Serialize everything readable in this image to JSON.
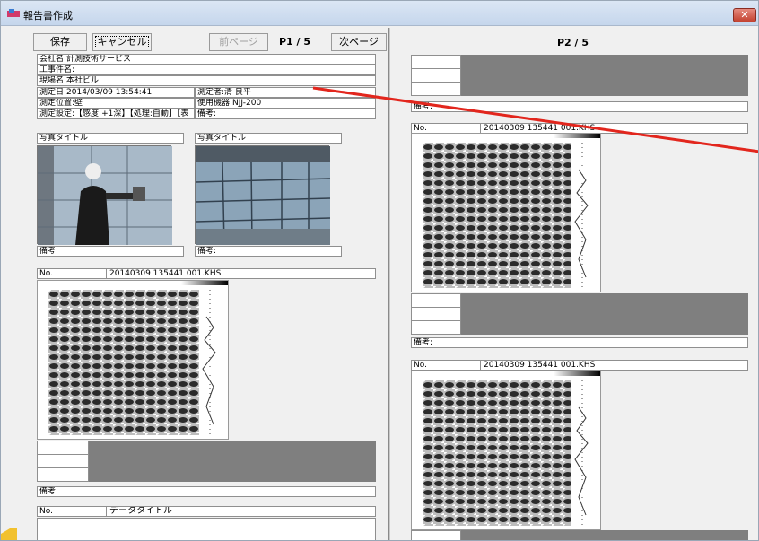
{
  "window": {
    "title": "報告書作成",
    "close_label": "✕"
  },
  "toolbar": {
    "save": "保存",
    "cancel": "キャンセル",
    "prev": "前ページ",
    "page_indicator": "P1 / 5",
    "next": "次ページ"
  },
  "page1": {
    "company": "会社名:計測技術サービス",
    "construction": "工事件名:",
    "site": "現場名:本社ビル",
    "date": "測定日:2014/03/09 13:54:41",
    "measurer": "測定者:清 良平",
    "position": "測定位置:壁",
    "device": "使用機器:NJJ-200",
    "settings": "測定設定:【感度:+1深】【処理:自動】【表",
    "remarks_header": "備考:",
    "photo1_title": "写真タイトル",
    "photo2_title": "写真タイトル",
    "photo1_remark": "備考:",
    "photo2_remark": "備考:",
    "data1_no": "No.",
    "data1_file": "20140309 135441 001.KHS",
    "data1_remark": "備考:",
    "data2_no": "No.",
    "data2_title": "データタイトル"
  },
  "page2": {
    "label": "P2 / 5",
    "remark1": "備考:",
    "data1_no": "No.",
    "data1_file": "20140309 135441 001.KHS",
    "remark2": "備考:",
    "data2_no": "No.",
    "data2_file": "20140309 135441 001.KHS"
  }
}
